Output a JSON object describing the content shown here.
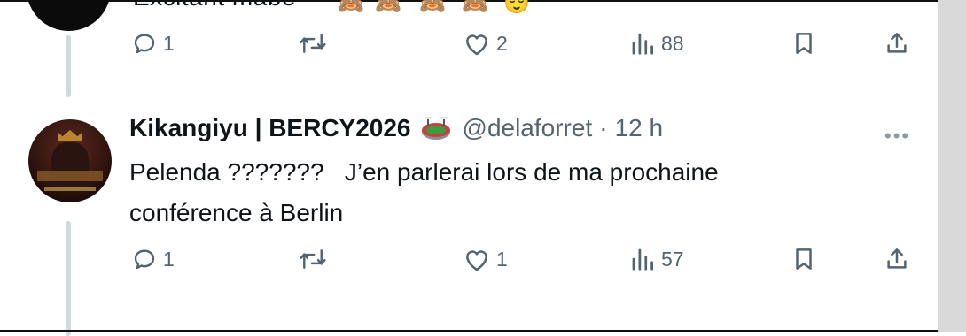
{
  "previous_tweet": {
    "text_fragment": "Excitant mabe",
    "emojis": [
      "🙈",
      "🙈",
      "🙈",
      "🙈",
      "😌"
    ],
    "actions": {
      "reply_count": "1",
      "retweet_count": "",
      "like_count": "2",
      "view_count": "88"
    }
  },
  "tweet": {
    "display_name": "Kikangiyu | BERCY2026",
    "badge_icon": "stadium-emoji",
    "handle": "@delaforret",
    "separator": "·",
    "time": "12 h",
    "more_label": "•••",
    "text_line1": "Pelenda ???????   J’en parlerai lors de ma prochaine",
    "text_line2": "conférence à Berlin",
    "actions": {
      "reply_count": "1",
      "retweet_count": "",
      "like_count": "1",
      "view_count": "57"
    }
  },
  "icons": {
    "reply": "reply-icon",
    "retweet": "retweet-icon",
    "like": "heart-icon",
    "views": "views-icon",
    "bookmark": "bookmark-icon",
    "share": "share-icon"
  },
  "colors": {
    "text": "#0f1419",
    "secondary": "#536471",
    "thread_line": "#cfd9de"
  }
}
